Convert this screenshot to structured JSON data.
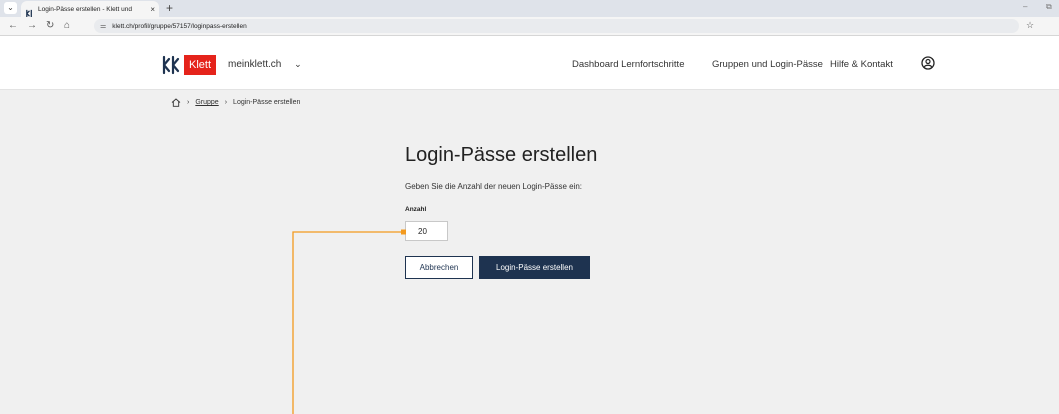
{
  "browser": {
    "tab_title": "Login-Pässe erstellen - Klett und",
    "tab_close": "×",
    "new_tab": "+",
    "url": "klett.ch/profil/gruppe/57157/loginpass-erstellen"
  },
  "header": {
    "brand": "Klett",
    "site_switch": "meinklett.ch",
    "nav": [
      {
        "label": "Dashboard Lernfortschritte"
      },
      {
        "label": "Gruppen und Login-Pässe"
      },
      {
        "label": "Hilfe & Kontakt"
      }
    ]
  },
  "breadcrumb": {
    "parent": "Gruppe",
    "current": "Login-Pässe erstellen"
  },
  "form": {
    "title": "Login-Pässe erstellen",
    "intro": "Geben Sie die Anzahl der neuen Login-Pässe ein:",
    "quantity_label": "Anzahl",
    "quantity_value": "20",
    "cancel_label": "Abbrechen",
    "submit_label": "Login-Pässe erstellen"
  },
  "colors": {
    "brand_red": "#e5231b",
    "primary_navy": "#1e3350",
    "annotation_orange": "#f39a1e"
  }
}
